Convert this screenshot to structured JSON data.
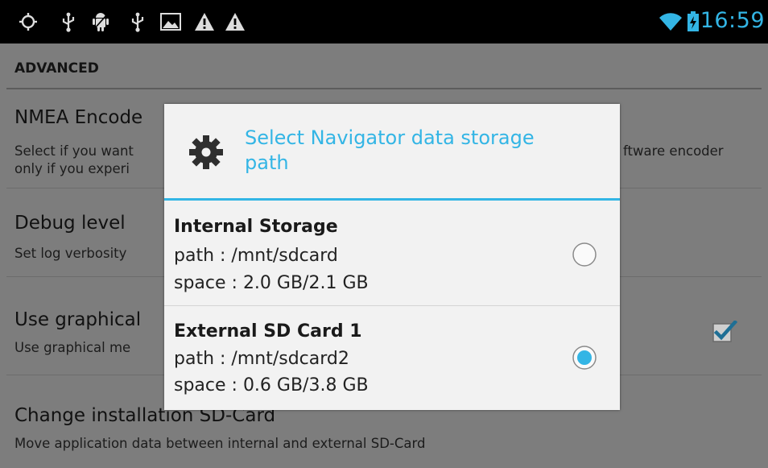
{
  "status_bar": {
    "left_icons": [
      "location-icon",
      "usb-icon",
      "android-debug-icon",
      "usb-icon",
      "image-icon",
      "warning-icon",
      "warning-icon"
    ],
    "right_icons": [
      "wifi-icon",
      "battery-charging-icon"
    ],
    "time": "16:59",
    "accent_color": "#33b5e5"
  },
  "settings": {
    "section_header": "ADVANCED",
    "items": [
      {
        "title": "NMEA Encode",
        "summary_line1": "Select if you want",
        "summary_line2": "only if you experi",
        "summary_right": "ftware encoder"
      },
      {
        "title": "Debug level",
        "summary_line1": "Set log verbosity"
      },
      {
        "title": "Use graphical",
        "summary_line1": "Use graphical me",
        "checked": true
      },
      {
        "title": "Change installation SD-Card",
        "summary_line1": "Move application data between internal and external SD-Card"
      }
    ]
  },
  "dialog": {
    "icon": "gear-icon",
    "title": "Select Navigator data storage path",
    "options": [
      {
        "name": "Internal Storage",
        "path": "path : /mnt/sdcard",
        "space": "space : 2.0 GB/2.1 GB",
        "selected": false
      },
      {
        "name": "External SD Card 1",
        "path": "path : /mnt/sdcard2",
        "space": "space : 0.6 GB/3.8 GB",
        "selected": true
      }
    ]
  }
}
